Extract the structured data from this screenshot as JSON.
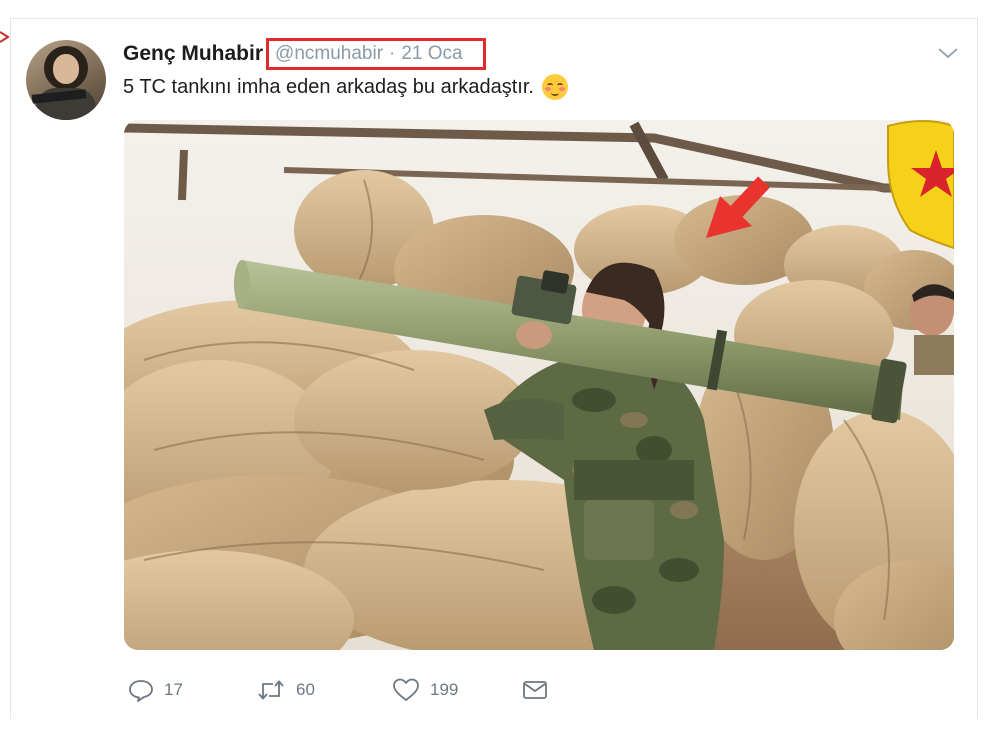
{
  "tweet": {
    "display_name": "Genç Muhabir",
    "handle": "@ncmuhabir",
    "separator": "·",
    "date": "21 Oca",
    "text": "5 TC tankını imha eden arkadaş bu arkadaştır.",
    "emoji": "blushing-smiling-face"
  },
  "actions": {
    "replies": "17",
    "retweets": "60",
    "likes": "199"
  },
  "icons": {
    "reply": "reply-icon",
    "retweet": "retweet-icon",
    "like": "heart-icon",
    "message": "direct-message-icon",
    "menu": "chevron-down-icon"
  },
  "colors": {
    "highlight_box": "#e02b2b",
    "annotation_arrow": "#e8332e",
    "meta_text": "#8a9aa6",
    "icon_gray": "#6b7883"
  }
}
